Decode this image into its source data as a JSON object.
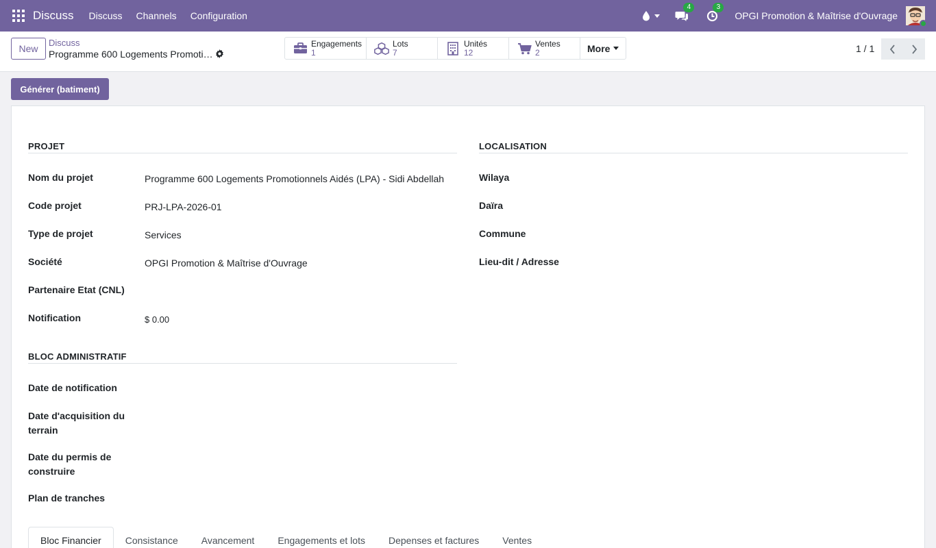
{
  "navbar": {
    "app_name": "Discuss",
    "menu": [
      "Discuss",
      "Channels",
      "Configuration"
    ],
    "messages_badge": "4",
    "activities_badge": "3",
    "company": "OPGI Promotion & Maîtrise d'Ouvrage",
    "accent": "#71639e"
  },
  "control_panel": {
    "new_label": "New",
    "breadcrumb": "Discuss",
    "record_title": "Programme 600 Logements Promotionnels Aidés (LPA) - Sidi Abdellah",
    "smart_buttons": [
      {
        "label": "Engagements",
        "value": "1",
        "icon": "briefcase-icon"
      },
      {
        "label": "Lots",
        "value": "7",
        "icon": "cubes-icon"
      },
      {
        "label": "Unités",
        "value": "12",
        "icon": "building-icon"
      },
      {
        "label": "Ventes",
        "value": "2",
        "icon": "cart-icon"
      }
    ],
    "more_label": "More",
    "pager": "1 / 1"
  },
  "status_bar": {
    "generate_label": "Générer (batiment)"
  },
  "form": {
    "projet": {
      "title": "PROJET",
      "fields": [
        {
          "label": "Nom du projet",
          "value": "Programme 600 Logements Promotionnels Aidés (LPA) - Sidi Abdellah"
        },
        {
          "label": "Code projet",
          "value": "PRJ-LPA-2026-01"
        },
        {
          "label": "Type de projet",
          "value": "Services"
        },
        {
          "label": "Société",
          "value": "OPGI Promotion & Maîtrise d'Ouvrage"
        },
        {
          "label": "Partenaire Etat (CNL)",
          "value": ""
        },
        {
          "label": "Notification",
          "value": "$ 0.00"
        }
      ]
    },
    "localisation": {
      "title": "LOCALISATION",
      "fields": [
        {
          "label": "Wilaya",
          "value": ""
        },
        {
          "label": "Daïra",
          "value": ""
        },
        {
          "label": "Commune",
          "value": ""
        },
        {
          "label": "Lieu-dit / Adresse",
          "value": ""
        }
      ]
    },
    "bloc_admin": {
      "title": "BLOC ADMINISTRATIF",
      "fields": [
        {
          "label": "Date de notification",
          "value": ""
        },
        {
          "label": "Date d'acquisition du terrain",
          "value": ""
        },
        {
          "label": "Date du permis de construire",
          "value": ""
        },
        {
          "label": "Plan de tranches",
          "value": ""
        }
      ]
    },
    "tabs": [
      "Bloc Financier",
      "Consistance",
      "Avancement",
      "Engagements et lots",
      "Depenses et factures",
      "Ventes"
    ]
  }
}
